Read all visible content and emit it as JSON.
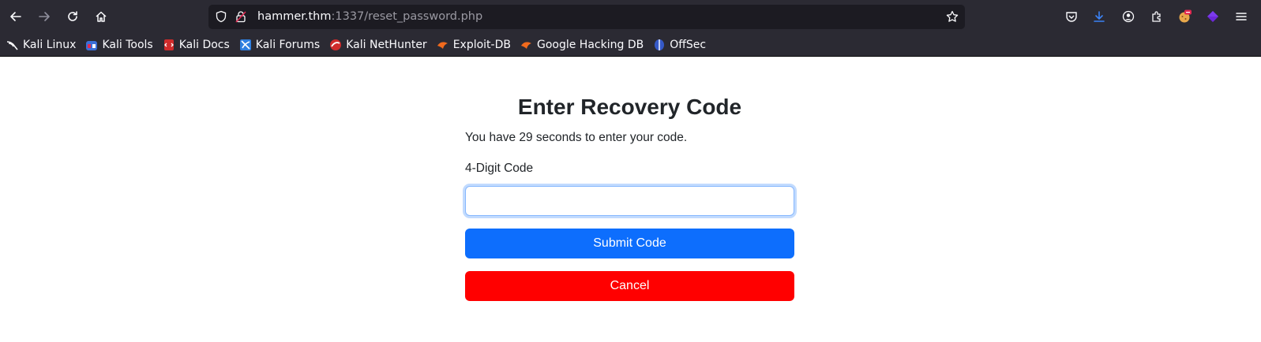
{
  "browser": {
    "url_host": "hammer.thm",
    "url_rest": ":1337/reset_password.php"
  },
  "bookmarks": [
    {
      "label": "Kali Linux",
      "icon": "kali-dragon-icon"
    },
    {
      "label": "Kali Tools",
      "icon": "kali-tools-icon"
    },
    {
      "label": "Kali Docs",
      "icon": "kali-docs-icon"
    },
    {
      "label": "Kali Forums",
      "icon": "kali-forums-icon"
    },
    {
      "label": "Kali NetHunter",
      "icon": "kali-nethunter-icon"
    },
    {
      "label": "Exploit-DB",
      "icon": "exploit-db-icon"
    },
    {
      "label": "Google Hacking DB",
      "icon": "ghdb-icon"
    },
    {
      "label": "OffSec",
      "icon": "offsec-icon"
    }
  ],
  "page": {
    "title": "Enter Recovery Code",
    "timer_text": "You have 29 seconds to enter your code.",
    "code_label": "4-Digit Code",
    "code_value": "",
    "submit_label": "Submit Code",
    "cancel_label": "Cancel"
  },
  "colors": {
    "chrome_bg": "#2b2a33",
    "urlbar_bg": "#1c1b22",
    "submit_bg": "#0d6efd",
    "cancel_bg": "#ff0000",
    "download_accent": "#3b82f6"
  }
}
